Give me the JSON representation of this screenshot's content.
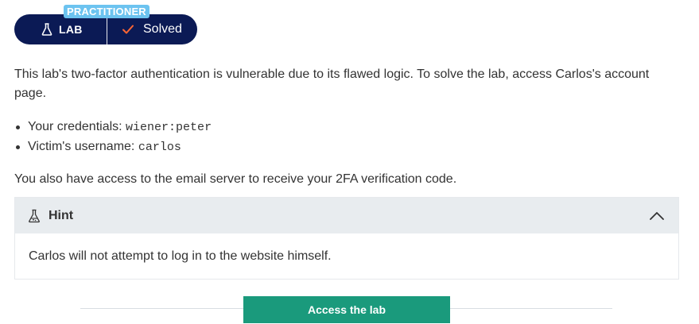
{
  "lab_widget": {
    "level": "PRACTITIONER",
    "lab_label": "LAB",
    "status": "Solved",
    "icons": {
      "flask": "flask-icon",
      "check": "check-icon"
    },
    "colors": {
      "pill_bg": "#0b1a55",
      "level_badge": "#6cc3f0",
      "check": "#ff6633"
    }
  },
  "description": "This lab's two-factor authentication is vulnerable due to its flawed logic. To solve the lab, access Carlos's account page.",
  "credentials": [
    {
      "label": "Your credentials: ",
      "value": "wiener:peter"
    },
    {
      "label": "Victim's username: ",
      "value": "carlos"
    }
  ],
  "email_note": "You also have access to the email server to receive your 2FA verification code.",
  "hint": {
    "title": "Hint",
    "body": "Carlos will not attempt to log in to the website himself.",
    "expanded": true,
    "icons": {
      "title": "flask-icon",
      "toggle": "chevron-up-icon"
    }
  },
  "access_button": {
    "label": "Access the lab",
    "color": "#1a9a7c"
  }
}
